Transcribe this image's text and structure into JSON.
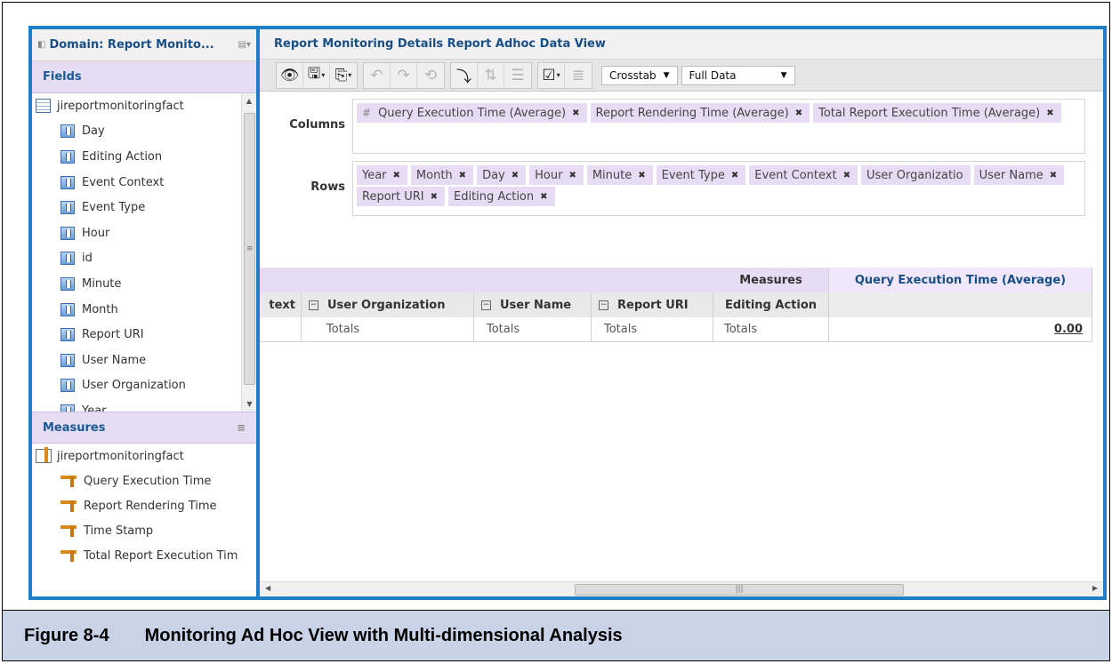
{
  "left": {
    "domain_title": "Domain: Report Monito...",
    "fields_header": "Fields",
    "fields_root": "jireportmonitoringfact",
    "fields": [
      "Day",
      "Editing Action",
      "Event Context",
      "Event Type",
      "Hour",
      "id",
      "Minute",
      "Month",
      "Report URI",
      "User Name",
      "User Organization",
      "Year"
    ],
    "measures_header": "Measures",
    "measures_root": "jireportmonitoringfact",
    "measures": [
      "Query Execution Time",
      "Report Rendering Time",
      "Time Stamp",
      "Total Report Execution Tim"
    ]
  },
  "right": {
    "title": "Report Monitoring Details Report Adhoc Data View",
    "view_type": "Crosstab",
    "data_size": "Full Data",
    "columns_label": "Columns",
    "rows_label": "Rows",
    "columns_hash": "#",
    "columns_pills": [
      "Query Execution Time (Average)",
      "Report Rendering Time (Average)",
      "Total Report Execution Time (Average)"
    ],
    "rows_pills": [
      "Year",
      "Month",
      "Day",
      "Hour",
      "Minute",
      "Event Type",
      "Event Context",
      "User Organizatio",
      "User Name",
      "Report URI",
      "Editing Action"
    ],
    "pill_remove": "✖",
    "grid": {
      "measures_label": "Measures",
      "measure_col": "Query Execution Time (Average)",
      "headers": [
        "text",
        "User Organization",
        "User Name",
        "Report URI",
        "Editing Action"
      ],
      "totals": [
        "Totals",
        "Totals",
        "Totals",
        "Totals"
      ],
      "value": "0.00"
    }
  },
  "caption": {
    "number": "Figure 8-4",
    "text": "Monitoring Ad Hoc View with Multi-dimensional Analysis"
  }
}
